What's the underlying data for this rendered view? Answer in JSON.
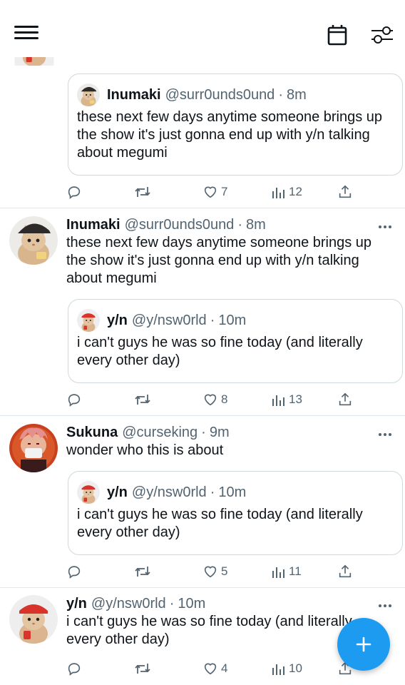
{
  "header": {
    "menu_icon": "hamburger-menu-icon",
    "calendar_icon": "calendar-icon",
    "settings_icon": "sliders-icon"
  },
  "tweets": [
    {
      "quote": {
        "name": "Inumaki",
        "handle": "@surr0unds0und",
        "sep": "·",
        "time": "8m",
        "text": "these next few days anytime someone brings up the show it's just gonna end up with y/n talking about megumi"
      },
      "actions": {
        "likes": "7",
        "views": "12"
      }
    },
    {
      "author": {
        "name": "Inumaki",
        "handle": "@surr0unds0und",
        "sep": "·",
        "time": "8m"
      },
      "text": "these next few days anytime someone brings up the show it's just gonna end up with y/n talking about megumi",
      "quote": {
        "name": "y/n",
        "handle": "@y/nsw0rld",
        "sep": "·",
        "time": "10m",
        "text": "i can't guys he was so fine today (and literally every other day)"
      },
      "actions": {
        "likes": "8",
        "views": "13"
      }
    },
    {
      "author": {
        "name": "Sukuna",
        "handle": "@curseking",
        "sep": "·",
        "time": "9m"
      },
      "text": "wonder who this is about",
      "quote": {
        "name": "y/n",
        "handle": "@y/nsw0rld",
        "sep": "·",
        "time": "10m",
        "text": "i can't guys he was so fine today (and literally every other day)"
      },
      "actions": {
        "likes": "5",
        "views": "11"
      }
    },
    {
      "author": {
        "name": "y/n",
        "handle": "@y/nsw0rld",
        "sep": "·",
        "time": "10m"
      },
      "text": "i can't guys he was so fine today (and literally every other day)",
      "actions": {
        "likes": "4",
        "views": "10"
      }
    }
  ],
  "fab": {
    "icon": "plus-icon"
  },
  "colors": {
    "accent": "#1d9bf0",
    "secondary_text": "#536471",
    "border": "#cfd9de"
  }
}
